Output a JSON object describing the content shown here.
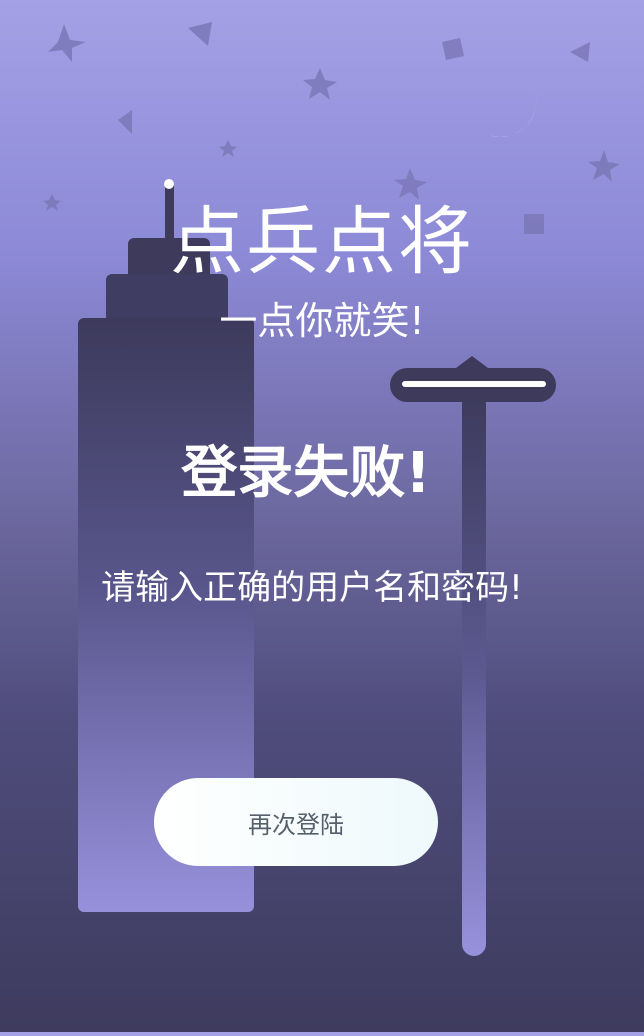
{
  "app": {
    "title": "点兵点将",
    "subtitle": "一点你就笑!"
  },
  "message": {
    "heading": "登录失败!",
    "detail": "请输入正确的用户名和密码!"
  },
  "actions": {
    "retry_label": "再次登陆"
  },
  "icons": {
    "moon": "moon-icon",
    "stars": "star-icon"
  },
  "colors": {
    "bg_top": "#a4a1e6",
    "bg_bottom": "#3e3b5e",
    "building": "#3d3a5c",
    "button_bg": "#ffffff",
    "button_text": "#56606d"
  }
}
